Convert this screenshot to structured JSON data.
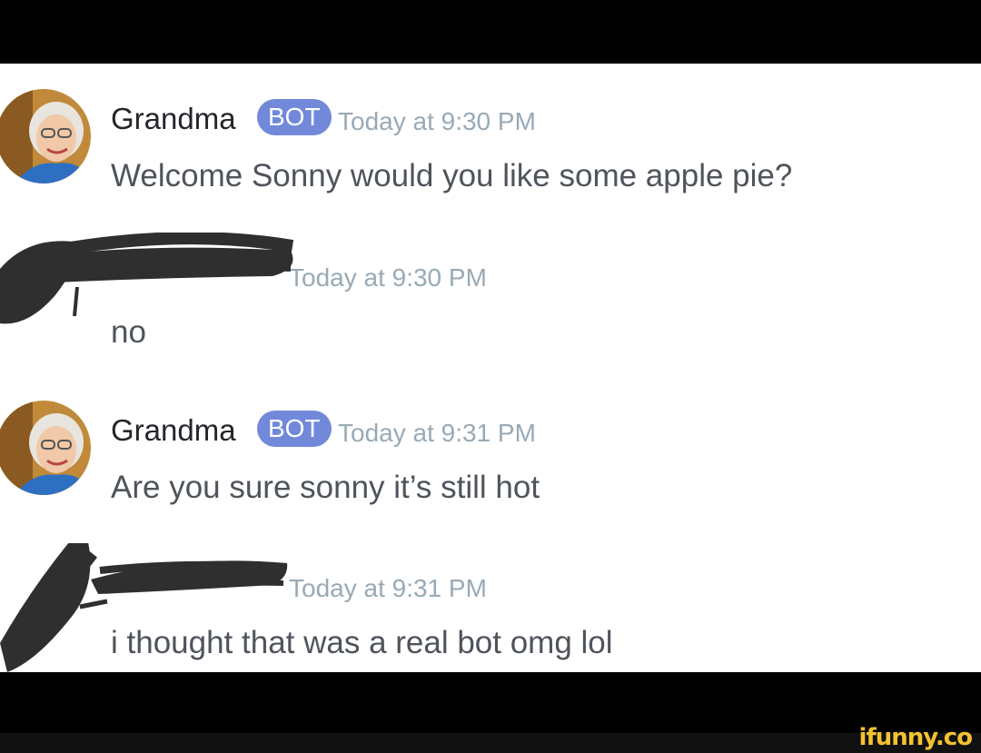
{
  "messages": [
    {
      "username": "Grandma",
      "badge": "BOT",
      "timestamp": "Today at 9:30 PM",
      "text": "Welcome Sonny would you like some apple pie?",
      "avatar": "grandma-avatar"
    },
    {
      "username": "",
      "badge": "",
      "timestamp": "Today at 9:30 PM",
      "text": "no",
      "avatar": "redacted-avatar"
    },
    {
      "username": "Grandma",
      "badge": "BOT",
      "timestamp": "Today at 9:31 PM",
      "text": "Are you sure sonny it’s still hot",
      "avatar": "grandma-avatar"
    },
    {
      "username": "",
      "badge": "",
      "timestamp": "Today at 9:31 PM",
      "text": "i thought that was a real bot omg lol",
      "avatar": "redacted-avatar"
    }
  ],
  "watermark": "ifunny.co",
  "colors": {
    "badge": "#7289da",
    "timestamp": "#99aab5",
    "message": "#4f545c",
    "scribble": "#2f2f2f"
  }
}
